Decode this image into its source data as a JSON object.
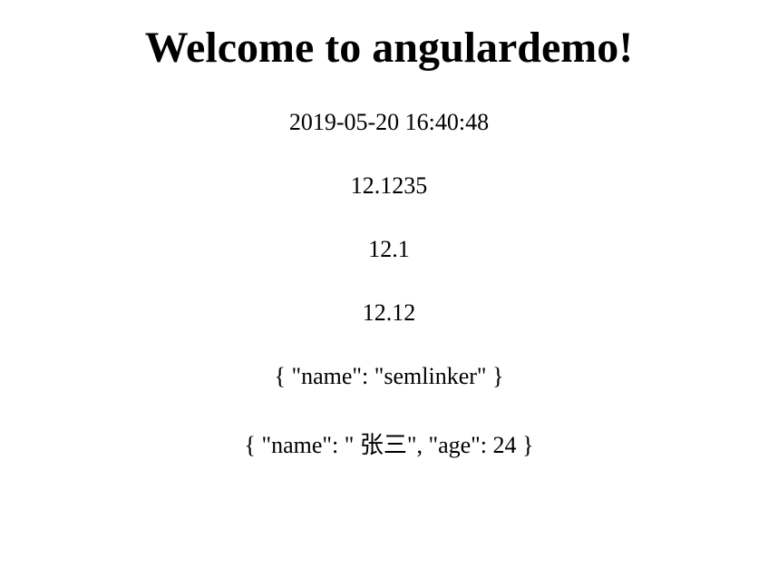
{
  "heading": "Welcome to angulardemo!",
  "lines": {
    "datetime": "2019-05-20 16:40:48",
    "num1": "12.1235",
    "num2": "12.1",
    "num3": "12.12",
    "json1": "{ \"name\": \"semlinker\" }",
    "json2": "{ \"name\": \" 张三\", \"age\": 24 }"
  }
}
